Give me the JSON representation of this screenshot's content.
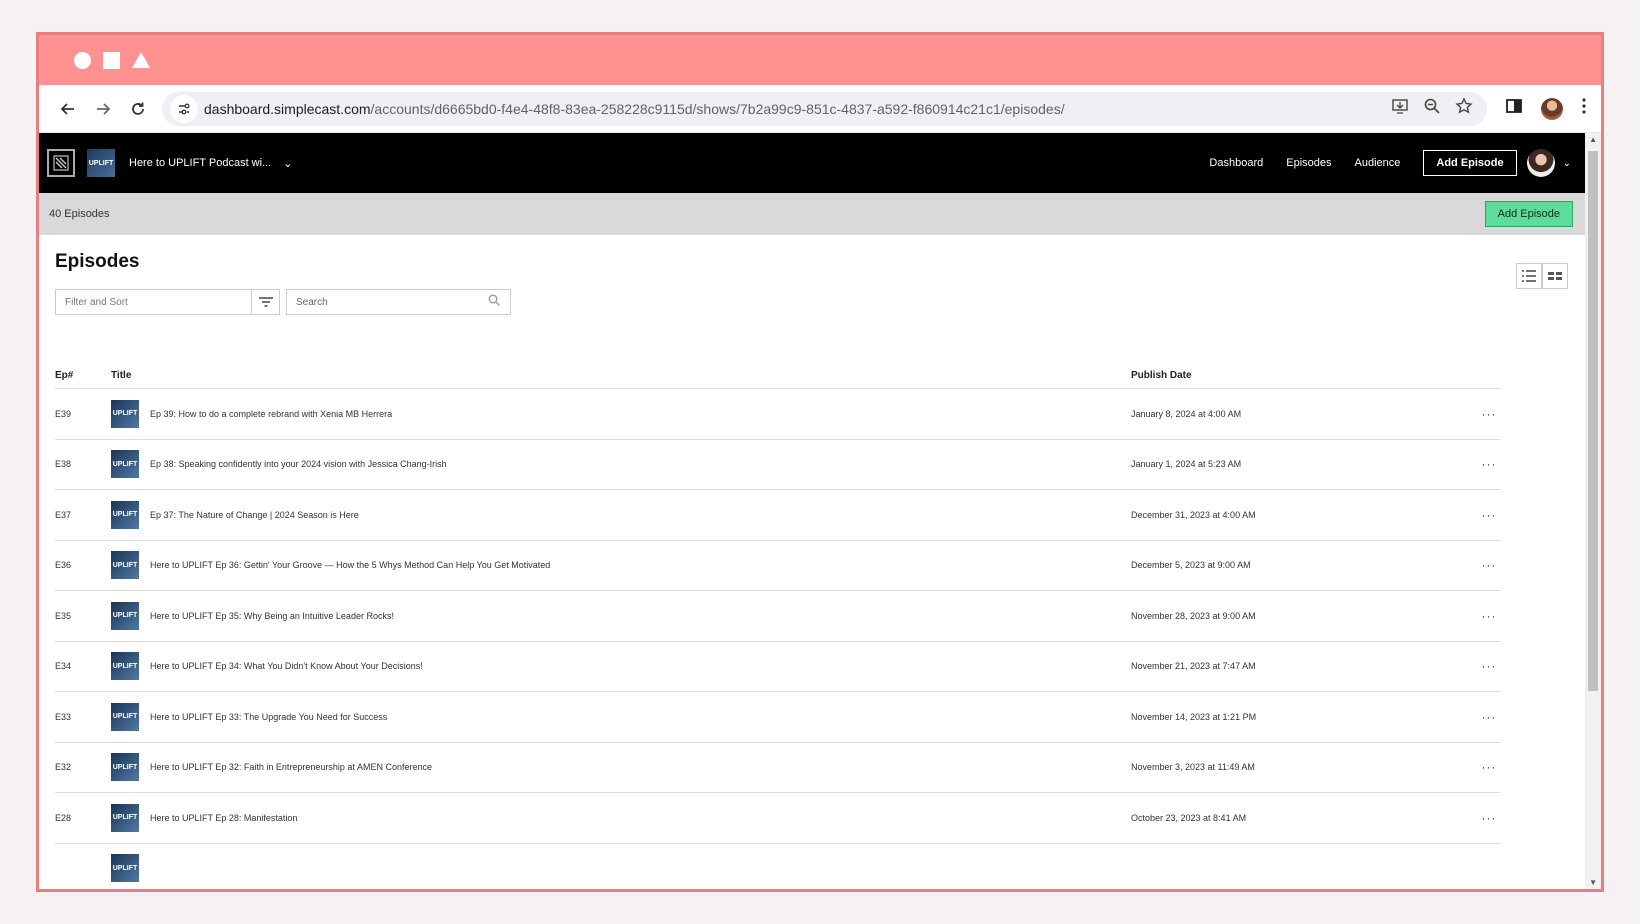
{
  "browser": {
    "url_domain": "dashboard.simplecast.com",
    "url_path": "/accounts/d6665bd0-f4e4-48f8-83ea-258228c9115d/shows/7b2a99c9-851c-4837-a592-f860914c21c1/episodes/"
  },
  "topnav": {
    "show_name": "Here to UPLIFT Podcast wi...",
    "thumb_text": "UPLIFT",
    "links": [
      "Dashboard",
      "Episodes",
      "Audience"
    ],
    "add_label": "Add Episode"
  },
  "subbar": {
    "count_text": "40 Episodes",
    "add_label": "Add Episode"
  },
  "page": {
    "title": "Episodes",
    "filter_placeholder": "Filter and Sort",
    "search_placeholder": "Search"
  },
  "table": {
    "headers": {
      "ep": "Ep#",
      "title": "Title",
      "date": "Publish Date"
    },
    "thumb_text": "UPLIFT",
    "rows": [
      {
        "ep": "E39",
        "title": "Ep 39: How to do a complete rebrand with Xenia MB Herrera",
        "date": "January 8, 2024 at 4:00 AM"
      },
      {
        "ep": "E38",
        "title": "Ep 38: Speaking confidently into your 2024 vision with Jessica Chang-Irish",
        "date": "January 1, 2024 at 5:23 AM"
      },
      {
        "ep": "E37",
        "title": "Ep 37: The Nature of Change | 2024 Season is Here",
        "date": "December 31, 2023 at 4:00 AM"
      },
      {
        "ep": "E36",
        "title": "Here to UPLIFT Ep 36: Gettin' Your Groove — How the 5 Whys Method Can Help You Get Motivated",
        "date": "December 5, 2023 at 9:00 AM"
      },
      {
        "ep": "E35",
        "title": "Here to UPLIFT Ep 35: Why Being an Intuitive Leader Rocks!",
        "date": "November 28, 2023 at 9:00 AM"
      },
      {
        "ep": "E34",
        "title": "Here to UPLIFT Ep 34: What You Didn't Know About Your Decisions!",
        "date": "November 21, 2023 at 7:47 AM"
      },
      {
        "ep": "E33",
        "title": "Here to UPLIFT Ep 33: The Upgrade You Need for Success",
        "date": "November 14, 2023 at 1:21 PM"
      },
      {
        "ep": "E32",
        "title": "Here to UPLIFT Ep 32: Faith in Entrepreneurship at AMEN Conference",
        "date": "November 3, 2023 at 11:49 AM"
      },
      {
        "ep": "E28",
        "title": "Here to UPLIFT Ep 28: Manifestation",
        "date": "October 23, 2023 at 8:41 AM"
      }
    ],
    "row_menu_glyph": "···"
  },
  "icons": [
    "back-arrow-icon",
    "forward-arrow-icon",
    "reload-icon",
    "site-settings-icon",
    "install-app-icon",
    "zoom-icon",
    "bookmark-star-icon",
    "side-panel-icon",
    "kebab-menu-icon",
    "simplecast-logo-icon",
    "chevron-down-icon",
    "list-view-icon",
    "grid-view-icon",
    "filter-icon",
    "search-icon"
  ],
  "colors": {
    "frame_accent": "#ff9291",
    "nav_bg": "#000000",
    "add_button_green": "#5ddc9b"
  }
}
